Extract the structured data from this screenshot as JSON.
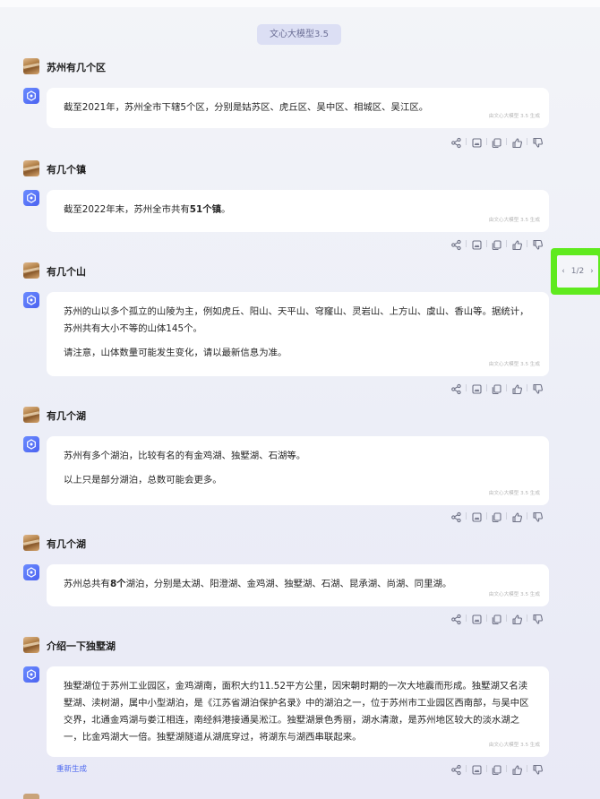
{
  "model_badge": "文心大模型3.5",
  "generated_mark": "由文心大模型 3.5 生成",
  "regenerate_label": "重新生成",
  "pager": {
    "label": "1/2",
    "prev": "‹",
    "next": "›"
  },
  "conversation": [
    {
      "question": "苏州有几个区",
      "answer": [
        [
          "截至2021年，苏州全市下辖5个区，分别是姑苏区、虎丘区、吴中区、相城区、吴江区。"
        ]
      ]
    },
    {
      "question": "有几个镇",
      "answer": [
        [
          "截至2022年末，苏州全市共有",
          {
            "b": "51个镇"
          },
          "。"
        ]
      ]
    },
    {
      "question": "有几个山",
      "answer": [
        [
          "苏州的山以多个孤立的山陵为主，例如虎丘、阳山、天平山、穹窿山、灵岩山、上方山、虞山、香山等。据统计，苏州共有大小不等的山体145个。"
        ],
        [
          "请注意，山体数量可能发生变化，请以最新信息为准。"
        ]
      ]
    },
    {
      "question": "有几个湖",
      "answer": [
        [
          "苏州有多个湖泊，比较有名的有金鸡湖、独墅湖、石湖等。"
        ],
        [
          "以上只是部分湖泊，总数可能会更多。"
        ]
      ]
    },
    {
      "question": "有几个湖",
      "answer": [
        [
          "苏州总共有",
          {
            "b": "8个"
          },
          "湖泊，分别是太湖、阳澄湖、金鸡湖、独墅湖、石湖、昆承湖、尚湖、同里湖。"
        ]
      ]
    },
    {
      "question": "介绍一下独墅湖",
      "answer": [
        [
          "独墅湖位于苏州工业园区，金鸡湖南，面积大约11.52平方公里，因宋朝时期的一次大地震而形成。独墅湖又名渎墅湖、渎树湖，属中小型湖泊，是《江苏省湖泊保护名录》中的湖泊之一，位于苏州市工业园区西南部，与吴中区交界，北通金鸡湖与娄江相连，南经斜港接通吴淞江。独墅湖景色秀丽，湖水清澈，是苏州地区较大的淡水湖之一，比金鸡湖大一倍。独墅湖隧道从湖底穿过，将湖东与湖西串联起来。"
        ]
      ]
    }
  ],
  "action_icons": [
    "share-icon",
    "image-icon",
    "copy-icon",
    "thumbs-up-icon",
    "thumbs-down-icon"
  ]
}
